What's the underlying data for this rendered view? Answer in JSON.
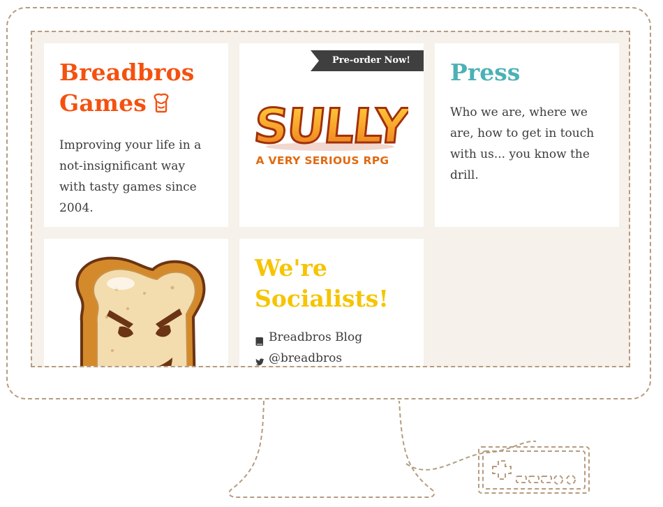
{
  "about": {
    "title_line1": "Breadbros",
    "title_line2": "Games",
    "description": "Improving your life in a not-insignificant way with tasty games since 2004."
  },
  "sully": {
    "ribbon_label": "Pre-order Now!",
    "logo_title": "SULLY",
    "logo_subtitle": "A VERY SERIOUS RPG"
  },
  "press": {
    "title": "Press",
    "description": "Who we are, where we are, how to get in touch with us... you know the drill."
  },
  "social": {
    "title_line1": "We're",
    "title_line2": "Socialists!",
    "links": [
      {
        "label": "Breadbros Blog",
        "icon": "book-icon"
      },
      {
        "label": "@breadbros",
        "icon": "twitter-icon"
      }
    ]
  },
  "colors": {
    "brand_orange": "#f4510f",
    "press_teal": "#4bb1b6",
    "social_yellow": "#f6c400",
    "ribbon_dark": "#3f3f3f",
    "screen_bg": "#f6f1ea",
    "outline": "#b59c80"
  }
}
